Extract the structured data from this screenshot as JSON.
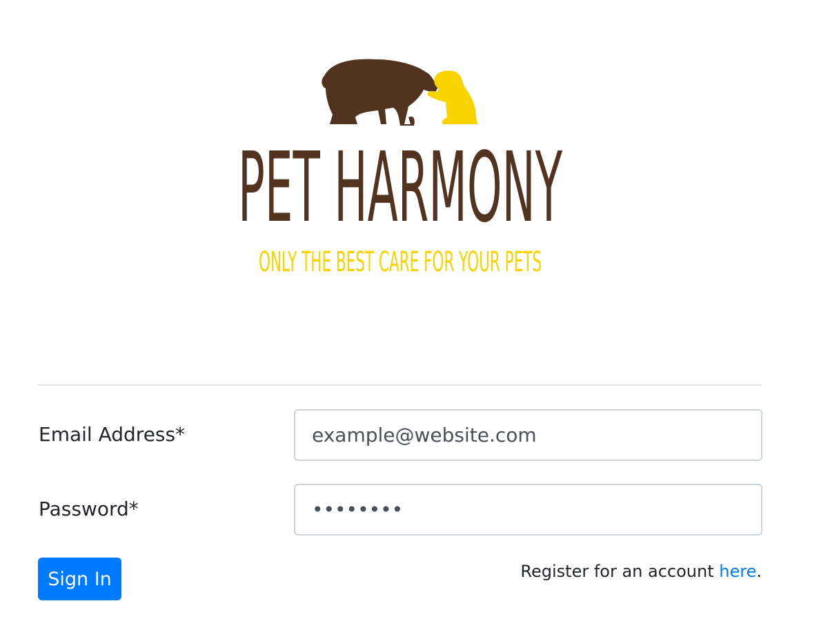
{
  "logo": {
    "title": "PET HARMONY",
    "tagline": "ONLY THE BEST CARE FOR YOUR PETS",
    "colors": {
      "brown": "#52331f",
      "yellow": "#f9d300"
    }
  },
  "form": {
    "email_label": "Email Address*",
    "email_value": "example@website.com",
    "password_label": "Password*",
    "password_value": "••••••••",
    "sign_in_label": "Sign In",
    "register_prefix": "Register for an account ",
    "register_link": "here",
    "register_suffix": "."
  }
}
